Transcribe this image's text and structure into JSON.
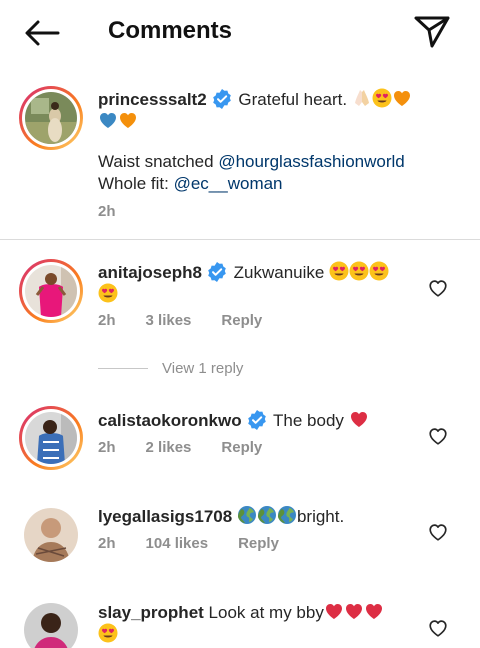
{
  "header": {
    "title": "Comments"
  },
  "caption": {
    "username": "princesssalt2",
    "text": "Grateful heart.",
    "line2_prefix": "Waist snatched ",
    "line2_mention": "@hourglassfashionworld",
    "line3_prefix": "Whole fit: ",
    "line3_mention": "@ec__woman",
    "time": "2h"
  },
  "comments": [
    {
      "username": "anitajoseph8",
      "text": "Zukwanuike",
      "time": "2h",
      "likes": "3 likes",
      "reply": "Reply",
      "view_replies": "View 1 reply"
    },
    {
      "username": "calistaokoronkwo",
      "text": "The body",
      "time": "2h",
      "likes": "2 likes",
      "reply": "Reply"
    },
    {
      "username": "lyegallasigs1708",
      "text": "bright.",
      "time": "2h",
      "likes": "104 likes",
      "reply": "Reply"
    },
    {
      "username": "slay_prophet",
      "text": "Look at my bby",
      "time": "",
      "likes": "",
      "reply": ""
    }
  ],
  "colors": {
    "verified": "#3897f0",
    "mention": "#00376b",
    "meta": "#8e8e8e",
    "heart_red": "#e0245e"
  }
}
